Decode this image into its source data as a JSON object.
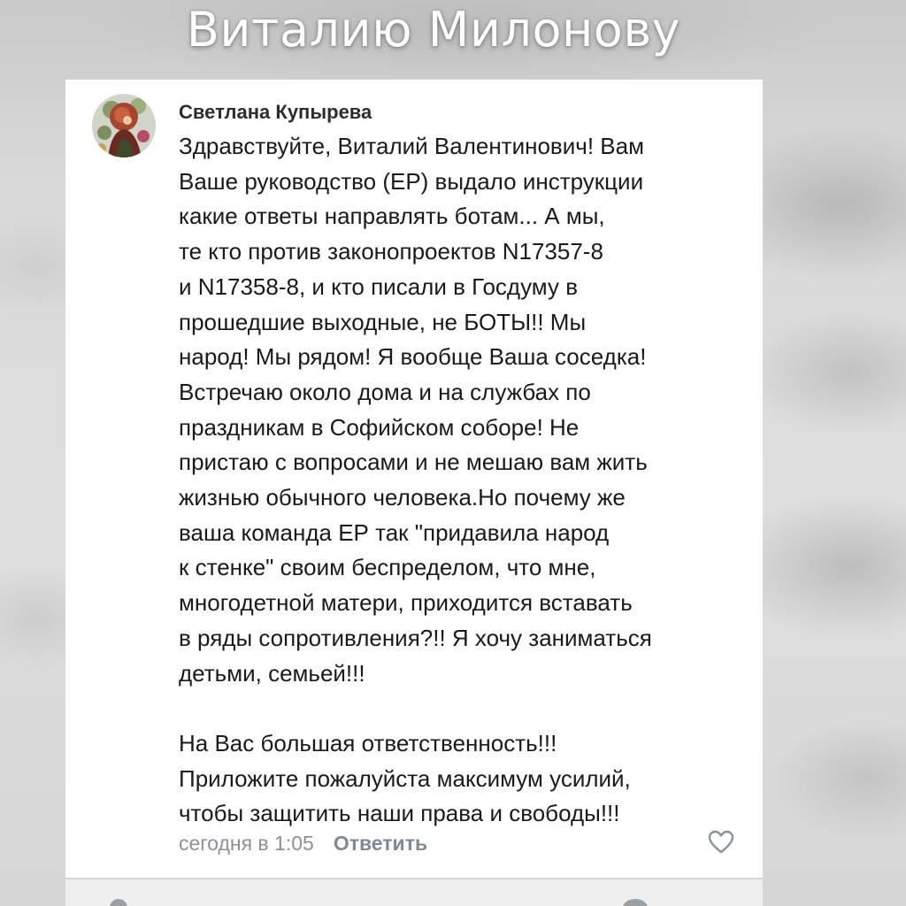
{
  "overlay": {
    "headline": "Виталию Милонову"
  },
  "comment": {
    "author": "Светлана Купырева",
    "avatar_icon": "user-avatar-photo",
    "text": "Здравствуйте, Виталий Валентинович! Вам\nВаше руководство (ЕР) выдало инструкции\nкакие ответы направлять ботам... А мы,\nте кто против законопроектов N17357-8\nи   N17358-8, и кто писали в Госдуму в\nпрошедшие выходные, не БОТЫ!! Мы\nнарод! Мы рядом! Я вообще Ваша соседка!\nВстречаю около дома и на службах по\nпраздникам в Софийском соборе! Не\nпристаю с вопросами и не мешаю вам жить\nжизнью обычного человека.Но почему же\nваша команда ЕР так \"придавила народ\nк стенке\" своим беспределом, что мне,\nмногодетной матери, приходится вставать\nв ряды сопротивления?!! Я хочу заниматься\nдетьми, семьей!!!\n\nНа Вас большая ответственность!!!\nПриложите пожалуйста максимум усилий,\nчтобы защитить наши права и свободы!!!",
    "timestamp": "сегодня в 1:05",
    "reply_label": "Ответить",
    "like_icon": "heart-outline-icon"
  },
  "colors": {
    "text": "#1a1a1a",
    "author": "#2d2d2d",
    "meta": "#8a9199",
    "headline": "#ffffff",
    "card": "#ffffff"
  }
}
